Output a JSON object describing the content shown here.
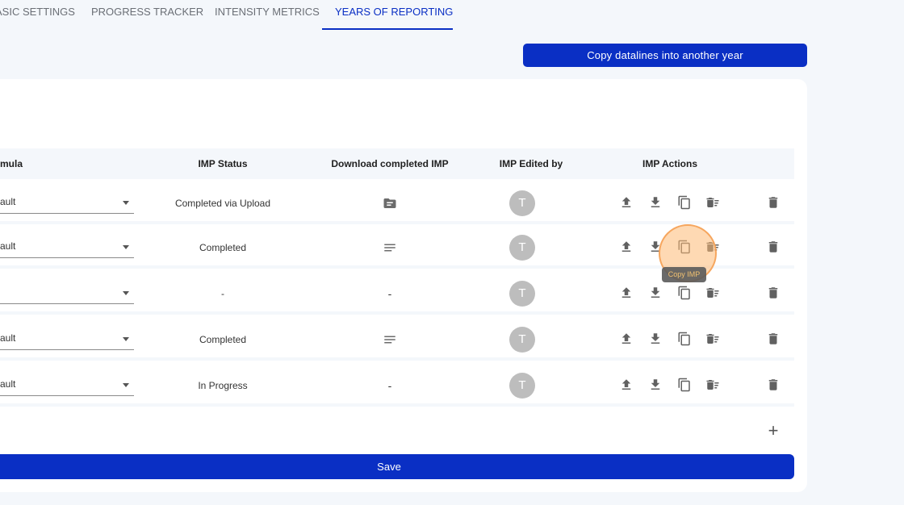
{
  "tabs": [
    {
      "label": "ASIC SETTINGS"
    },
    {
      "label": "PROGRESS TRACKER"
    },
    {
      "label": "INTENSITY METRICS"
    },
    {
      "label": "YEARS OF REPORTING"
    }
  ],
  "copy_button": "Copy datalines into another year",
  "table": {
    "headers": {
      "formula": "mula",
      "imp_status": "IMP Status",
      "download": "Download completed IMP",
      "edited_by": "IMP Edited by",
      "actions": "IMP Actions"
    },
    "rows": [
      {
        "formula": "ault",
        "status": "Completed via Upload",
        "download": "folder-icon",
        "avatar": "T"
      },
      {
        "formula": "ault",
        "status": "Completed",
        "download": "notes-icon",
        "avatar": "T"
      },
      {
        "formula": "",
        "status": "-",
        "download": "-",
        "avatar": "T"
      },
      {
        "formula": "ault",
        "status": "Completed",
        "download": "notes-icon",
        "avatar": "T"
      },
      {
        "formula": "ault",
        "status": "In Progress",
        "download": "-",
        "avatar": "T"
      }
    ]
  },
  "tooltip": "Copy IMP",
  "add_button": "+",
  "save_button": "Save",
  "colors": {
    "primary": "#0a2fc4",
    "highlight": "#fdba74"
  }
}
